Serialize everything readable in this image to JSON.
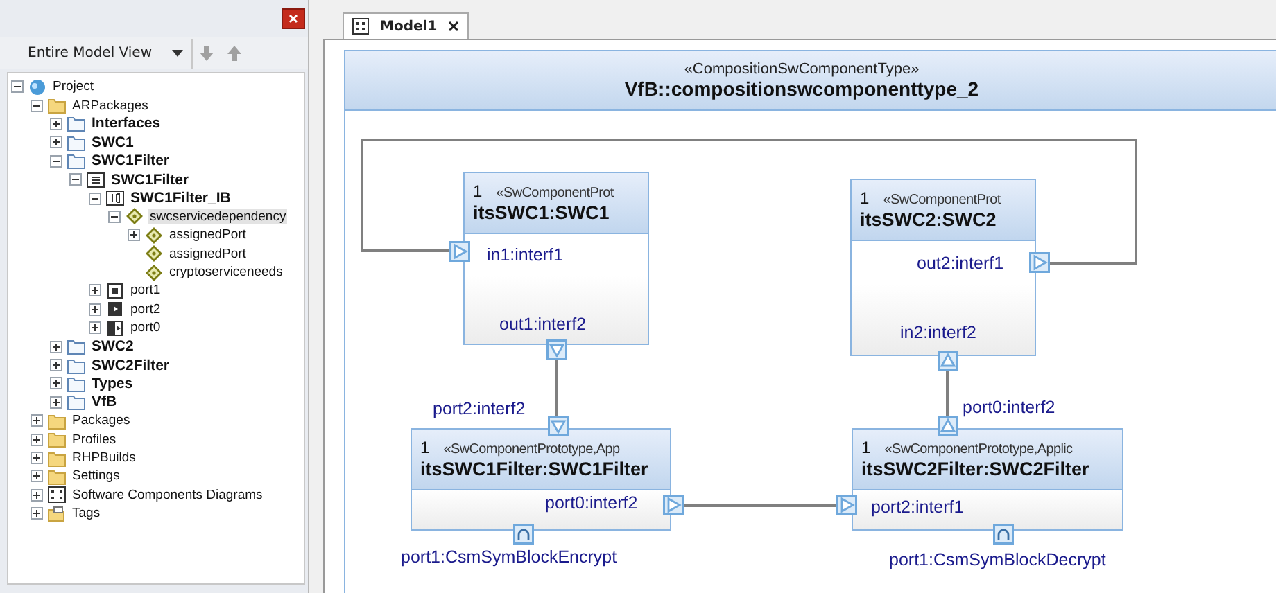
{
  "browser": {
    "view_selector": "Entire Model View"
  },
  "tree": [
    {
      "label": "Project",
      "kind": "project",
      "bold": false,
      "expanded": true,
      "selected": false,
      "children": [
        {
          "label": "ARPackages",
          "kind": "folder",
          "bold": false,
          "expanded": true,
          "selected": false,
          "children": [
            {
              "label": "Interfaces",
              "kind": "package",
              "bold": true,
              "expanded": false,
              "selected": false
            },
            {
              "label": "SWC1",
              "kind": "package",
              "bold": true,
              "expanded": false,
              "selected": false
            },
            {
              "label": "SWC1Filter",
              "kind": "package",
              "bold": true,
              "expanded": true,
              "selected": false,
              "children": [
                {
                  "label": "SWC1Filter",
                  "kind": "component",
                  "bold": true,
                  "expanded": true,
                  "selected": false,
                  "children": [
                    {
                      "label": "SWC1Filter_IB",
                      "kind": "behavior",
                      "bold": true,
                      "expanded": true,
                      "selected": false,
                      "children": [
                        {
                          "label": "swcservicedependency",
                          "kind": "diamond",
                          "bold": false,
                          "expanded": true,
                          "selected": true,
                          "children": [
                            {
                              "label": "assignedPort",
                              "kind": "diamond",
                              "bold": false,
                              "expanded": false,
                              "selected": false
                            },
                            {
                              "label": "assignedPort",
                              "kind": "diamond",
                              "bold": false,
                              "selected": false
                            },
                            {
                              "label": "cryptoserviceneeds",
                              "kind": "diamond",
                              "bold": false,
                              "selected": false
                            }
                          ]
                        }
                      ]
                    },
                    {
                      "label": "port1",
                      "kind": "port-client",
                      "bold": false,
                      "expanded": false,
                      "selected": false
                    },
                    {
                      "label": "port2",
                      "kind": "port-sender",
                      "bold": false,
                      "expanded": false,
                      "selected": false
                    },
                    {
                      "label": "port0",
                      "kind": "port-receiver",
                      "bold": false,
                      "expanded": false,
                      "selected": false
                    }
                  ]
                }
              ]
            },
            {
              "label": "SWC2",
              "kind": "package",
              "bold": true,
              "expanded": false,
              "selected": false
            },
            {
              "label": "SWC2Filter",
              "kind": "package",
              "bold": true,
              "expanded": false,
              "selected": false
            },
            {
              "label": "Types",
              "kind": "package",
              "bold": true,
              "expanded": false,
              "selected": false
            },
            {
              "label": "VfB",
              "kind": "package",
              "bold": true,
              "expanded": false,
              "selected": false
            }
          ]
        },
        {
          "label": "Packages",
          "kind": "folder",
          "bold": false,
          "expanded": false,
          "selected": false
        },
        {
          "label": "Profiles",
          "kind": "folder",
          "bold": false,
          "expanded": false,
          "selected": false
        },
        {
          "label": "RHPBuilds",
          "kind": "folder",
          "bold": false,
          "expanded": false,
          "selected": false
        },
        {
          "label": "Settings",
          "kind": "folder",
          "bold": false,
          "expanded": false,
          "selected": false
        },
        {
          "label": "Software Components Diagrams",
          "kind": "diagram",
          "bold": false,
          "expanded": false,
          "selected": false
        },
        {
          "label": "Tags",
          "kind": "tags",
          "bold": false,
          "expanded": false,
          "selected": false
        }
      ]
    }
  ],
  "tabs": [
    {
      "label": "Model1",
      "selected": true
    }
  ],
  "diagram": {
    "stereotype": "«CompositionSwComponentType»",
    "title": "VfB::compositionswcomponenttype_2",
    "parts": [
      {
        "multiplicity": "1",
        "stereotype": "«SwComponentProt",
        "name": "itsSWC1:SWC1",
        "ports": [
          {
            "label": "in1:interf1",
            "kind": "right"
          },
          {
            "label": "out1:interf2",
            "kind": "down"
          }
        ]
      },
      {
        "multiplicity": "1",
        "stereotype": "«SwComponentProt",
        "name": "itsSWC2:SWC2",
        "ports": [
          {
            "label": "out2:interf1",
            "kind": "right"
          },
          {
            "label": "in2:interf2",
            "kind": "up"
          }
        ]
      },
      {
        "multiplicity": "1",
        "stereotype": "«SwComponentPrototype,App",
        "name": "itsSWC1Filter:SWC1Filter",
        "ports": [
          {
            "label": "port2:interf2",
            "kind": "down"
          },
          {
            "label": "port0:interf2",
            "kind": "right"
          },
          {
            "label": "port1:CsmSymBlockEncrypt",
            "kind": "socket"
          }
        ]
      },
      {
        "multiplicity": "1",
        "stereotype": "«SwComponentPrototype,Applic",
        "name": "itsSWC2Filter:SWC2Filter",
        "ports": [
          {
            "label": "port0:interf2",
            "kind": "up"
          },
          {
            "label": "port2:interf1",
            "kind": "right"
          },
          {
            "label": "port1:CsmSymBlockDecrypt",
            "kind": "socket"
          }
        ]
      }
    ]
  }
}
